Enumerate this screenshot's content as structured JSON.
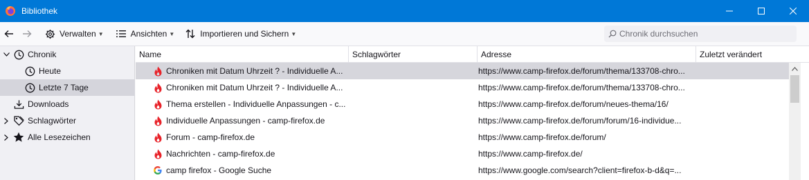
{
  "window": {
    "title": "Bibliothek",
    "controls": {
      "minimize": "minimize-icon",
      "maximize": "maximize-icon",
      "close": "close-icon"
    }
  },
  "toolbar": {
    "back_icon": "arrow-left-icon",
    "forward_icon": "arrow-right-icon",
    "organize_label": "Verwalten",
    "views_label": "Ansichten",
    "import_label": "Importieren und Sichern",
    "search_placeholder": "Chronik durchsuchen"
  },
  "sidebar": {
    "items": [
      {
        "label": "Chronik",
        "expanded": true,
        "icon": "clock-icon",
        "level": 0,
        "selected": false
      },
      {
        "label": "Heute",
        "icon": "clock-icon",
        "level": 1,
        "selected": false
      },
      {
        "label": "Letzte 7 Tage",
        "icon": "clock-icon",
        "level": 1,
        "selected": true
      },
      {
        "label": "Downloads",
        "icon": "download-icon",
        "level": 0,
        "selected": false
      },
      {
        "label": "Schlagwörter",
        "expanded": false,
        "icon": "tags-icon",
        "level": 0,
        "selected": false
      },
      {
        "label": "Alle Lesezeichen",
        "expanded": false,
        "icon": "star-icon",
        "level": 0,
        "selected": false
      }
    ]
  },
  "table": {
    "columns": [
      "Name",
      "Schlagwörter",
      "Adresse",
      "Zuletzt verändert"
    ],
    "rows": [
      {
        "name": "Chroniken mit Datum Uhrzeit ? - Individuelle A...",
        "tags": "",
        "url": "https://www.camp-firefox.de/forum/thema/133708-chro...",
        "modified": "",
        "favicon": "camp-firefox-icon",
        "selected": true
      },
      {
        "name": "Chroniken mit Datum Uhrzeit ? - Individuelle A...",
        "tags": "",
        "url": "https://www.camp-firefox.de/forum/thema/133708-chro...",
        "modified": "",
        "favicon": "camp-firefox-icon",
        "selected": false
      },
      {
        "name": "Thema erstellen - Individuelle Anpassungen - c...",
        "tags": "",
        "url": "https://www.camp-firefox.de/forum/neues-thema/16/",
        "modified": "",
        "favicon": "camp-firefox-icon",
        "selected": false
      },
      {
        "name": "Individuelle Anpassungen - camp-firefox.de",
        "tags": "",
        "url": "https://www.camp-firefox.de/forum/forum/16-individue...",
        "modified": "",
        "favicon": "camp-firefox-icon",
        "selected": false
      },
      {
        "name": "Forum - camp-firefox.de",
        "tags": "",
        "url": "https://www.camp-firefox.de/forum/",
        "modified": "",
        "favicon": "camp-firefox-icon",
        "selected": false
      },
      {
        "name": "Nachrichten - camp-firefox.de",
        "tags": "",
        "url": "https://www.camp-firefox.de/",
        "modified": "",
        "favicon": "camp-firefox-icon",
        "selected": false
      },
      {
        "name": "camp firefox - Google Suche",
        "tags": "",
        "url": "https://www.google.com/search?client=firefox-b-d&q=...",
        "modified": "",
        "favicon": "google-icon",
        "selected": false
      }
    ]
  },
  "colors": {
    "titlebar": "#0078d7",
    "selected_row": "#d6d6dc",
    "fire_icon": "#e8232a"
  }
}
